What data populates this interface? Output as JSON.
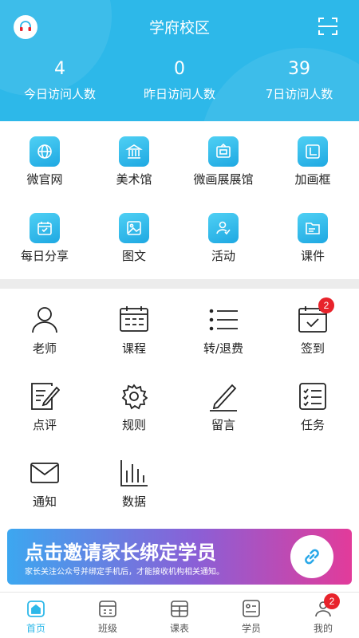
{
  "header": {
    "title": "学府校区",
    "left_icon": "headset-icon",
    "right_icon": "scan-icon",
    "stats": [
      {
        "value": "4",
        "label": "今日访问人数"
      },
      {
        "value": "0",
        "label": "昨日访问人数"
      },
      {
        "value": "39",
        "label": "7日访问人数"
      }
    ]
  },
  "feature_grid": [
    {
      "label": "微官网",
      "icon": "globe-icon"
    },
    {
      "label": "美术馆",
      "icon": "museum-icon"
    },
    {
      "label": "微画展展馆",
      "icon": "easel-icon"
    },
    {
      "label": "加画框",
      "icon": "frame-icon"
    },
    {
      "label": "每日分享",
      "icon": "calendar-icon"
    },
    {
      "label": "图文",
      "icon": "image-icon"
    },
    {
      "label": "活动",
      "icon": "user-check-icon"
    },
    {
      "label": "课件",
      "icon": "folder-icon"
    }
  ],
  "manage_grid": [
    {
      "label": "老师",
      "icon": "person-icon"
    },
    {
      "label": "课程",
      "icon": "timetable-icon"
    },
    {
      "label": "转/退费",
      "icon": "list-icon"
    },
    {
      "label": "签到",
      "icon": "calendar-check-icon",
      "badge": "2"
    },
    {
      "label": "点评",
      "icon": "edit-document-icon"
    },
    {
      "label": "规则",
      "icon": "gear-icon"
    },
    {
      "label": "留言",
      "icon": "pen-icon"
    },
    {
      "label": "任务",
      "icon": "checklist-icon"
    },
    {
      "label": "通知",
      "icon": "mail-icon"
    },
    {
      "label": "数据",
      "icon": "bar-chart-icon"
    }
  ],
  "banner": {
    "title": "点击邀请家长绑定学员",
    "subtitle": "家长关注公众号并绑定手机后，才能接收机构相关通知。",
    "icon": "link-icon"
  },
  "tabbar": [
    {
      "label": "首页",
      "icon": "home-icon",
      "active": true
    },
    {
      "label": "班级",
      "icon": "class-icon"
    },
    {
      "label": "课表",
      "icon": "schedule-icon"
    },
    {
      "label": "学员",
      "icon": "student-icon"
    },
    {
      "label": "我的",
      "icon": "profile-icon",
      "badge": "2"
    }
  ],
  "colors": {
    "primary": "#2db8e9",
    "badge": "#e8232b",
    "divider": "#ececec"
  }
}
